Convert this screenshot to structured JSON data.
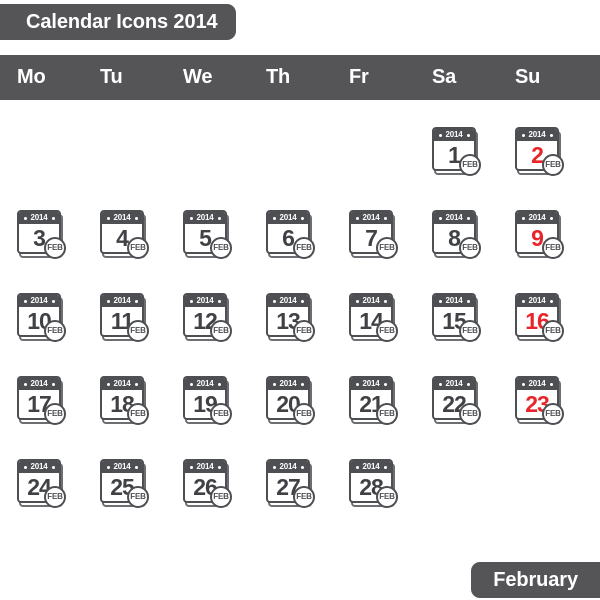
{
  "header": {
    "title": "Calendar Icons 2014"
  },
  "weekdays": [
    {
      "label": "Mo"
    },
    {
      "label": "Tu"
    },
    {
      "label": "We"
    },
    {
      "label": "Th"
    },
    {
      "label": "Fr"
    },
    {
      "label": "Sa"
    },
    {
      "label": "Su"
    }
  ],
  "footer": {
    "month_label": "February"
  },
  "icon": {
    "year_label": "2014",
    "month_abbrev": "FEB"
  },
  "colors": {
    "chrome_dark": "#555558",
    "icon_outline": "#4d4f53",
    "icon_shadow": "#6d6e71",
    "day_text": "#3f4144",
    "weekend_text": "#e8252a",
    "background": "#ffffff"
  },
  "calendar": {
    "month": "February",
    "year": "2014",
    "weeks": [
      [
        {
          "day": null
        },
        {
          "day": null
        },
        {
          "day": null
        },
        {
          "day": null
        },
        {
          "day": null
        },
        {
          "day": "1",
          "weekend": false
        },
        {
          "day": "2",
          "weekend": true
        }
      ],
      [
        {
          "day": "3",
          "weekend": false
        },
        {
          "day": "4",
          "weekend": false
        },
        {
          "day": "5",
          "weekend": false
        },
        {
          "day": "6",
          "weekend": false
        },
        {
          "day": "7",
          "weekend": false
        },
        {
          "day": "8",
          "weekend": false
        },
        {
          "day": "9",
          "weekend": true
        }
      ],
      [
        {
          "day": "10",
          "weekend": false
        },
        {
          "day": "11",
          "weekend": false
        },
        {
          "day": "12",
          "weekend": false
        },
        {
          "day": "13",
          "weekend": false
        },
        {
          "day": "14",
          "weekend": false
        },
        {
          "day": "15",
          "weekend": false
        },
        {
          "day": "16",
          "weekend": true
        }
      ],
      [
        {
          "day": "17",
          "weekend": false
        },
        {
          "day": "18",
          "weekend": false
        },
        {
          "day": "19",
          "weekend": false
        },
        {
          "day": "20",
          "weekend": false
        },
        {
          "day": "21",
          "weekend": false
        },
        {
          "day": "22",
          "weekend": false
        },
        {
          "day": "23",
          "weekend": true
        }
      ],
      [
        {
          "day": "24",
          "weekend": false
        },
        {
          "day": "25",
          "weekend": false
        },
        {
          "day": "26",
          "weekend": false
        },
        {
          "day": "27",
          "weekend": false
        },
        {
          "day": "28",
          "weekend": false
        },
        {
          "day": null
        },
        {
          "day": null
        }
      ]
    ]
  }
}
